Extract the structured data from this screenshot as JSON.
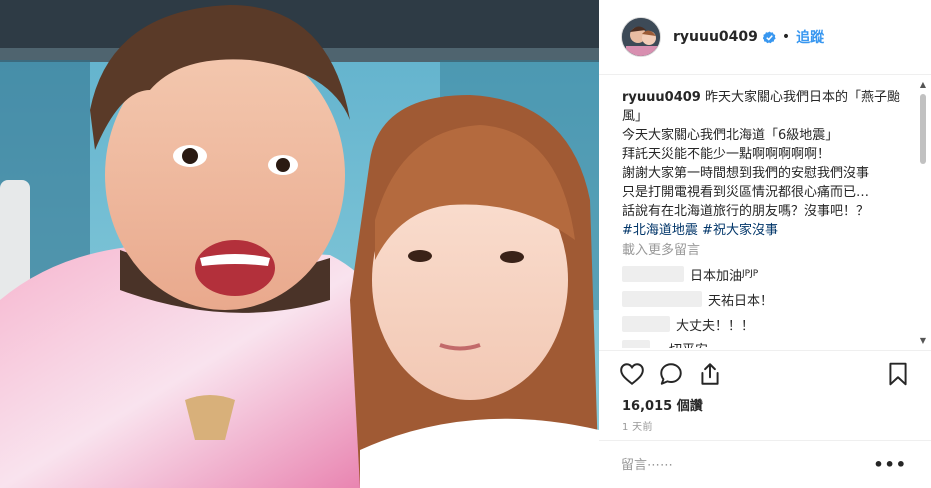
{
  "post": {
    "photo_alt": "selfie photo",
    "colors": {
      "accent": "#3897f0",
      "hashtag": "#003569",
      "muted": "#999999"
    }
  },
  "header": {
    "username": "ryuuu0409",
    "verified_icon": "verified-badge-icon",
    "separator": "•",
    "follow_label": "追蹤"
  },
  "caption": {
    "username": "ryuuu0409",
    "line1": " 昨天大家關心我們日本的「燕子颱風」",
    "line2": "今天大家關心我們北海道「6級地震」",
    "line3": "拜託天災能不能少一點啊啊啊啊啊！",
    "line4": "謝謝大家第一時間想到我們的安慰我們沒事",
    "line5": "只是打開電視看到災區情況都很心痛而已…",
    "line6": "話說有在北海道旅行的朋友嗎？沒事吧！？",
    "tag1": "#北海道地震",
    "tag2": "#祝大家沒事"
  },
  "load_more": "載入更多留言",
  "comments": [
    {
      "text": "日本加油",
      "suffix": "JPJP"
    },
    {
      "text": "天祐日本！"
    },
    {
      "text": "大丈夫！！！"
    },
    {
      "text": "一切平安"
    }
  ],
  "actions": {
    "like_icon": "heart-icon",
    "comment_icon": "comment-icon",
    "share_icon": "share-icon",
    "save_icon": "bookmark-icon"
  },
  "likes": {
    "count": "16,015",
    "label": " 個讚"
  },
  "time": "1 天前",
  "add_comment": {
    "placeholder": "留言⋯⋯",
    "more_label": "•••"
  }
}
